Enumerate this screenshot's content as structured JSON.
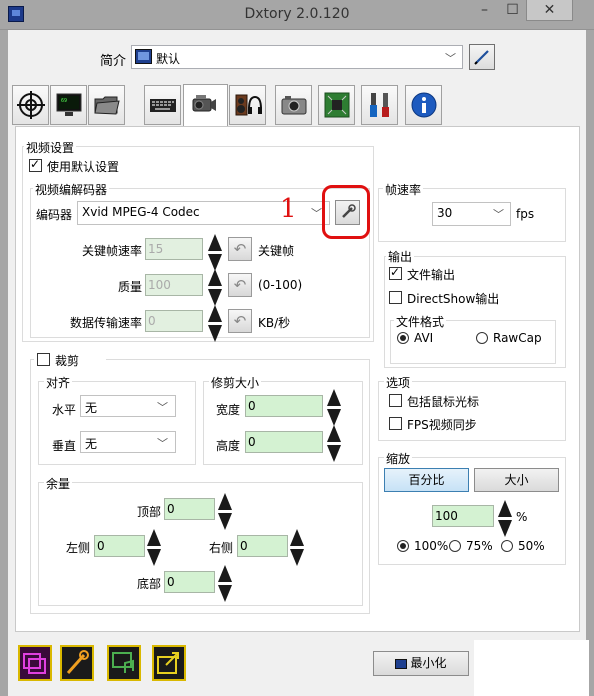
{
  "window": {
    "title": "Dxtory 2.0.120",
    "minimize": "–",
    "maximize": "☐",
    "close": "✕"
  },
  "profile": {
    "label": "简介",
    "value": "默认"
  },
  "tabs": [
    {
      "icon": "crosshair-icon"
    },
    {
      "icon": "monitor-icon"
    },
    {
      "icon": "folder-icon"
    },
    {
      "icon": "keyboard-icon"
    },
    {
      "icon": "video-camera-icon"
    },
    {
      "icon": "speaker-headphones-icon"
    },
    {
      "icon": "photo-camera-icon"
    },
    {
      "icon": "chip-icon"
    },
    {
      "icon": "tools-icon"
    },
    {
      "icon": "info-icon"
    }
  ],
  "video": {
    "section_label": "视频设置",
    "use_default_label": "使用默认设置",
    "codec_group_label": "视频编解码器",
    "codec_label": "编码器",
    "codec_value": "Xvid MPEG-4 Codec",
    "annotation": "1",
    "keyframe_label": "关键帧速率",
    "keyframe_value": "15",
    "keyframe_unit": "关键帧",
    "quality_label": "质量",
    "quality_value": "100",
    "quality_unit": "(0-100)",
    "datarate_label": "数据传输速率",
    "datarate_value": "0",
    "datarate_unit": "KB/秒"
  },
  "fps": {
    "label": "帧速率",
    "value": "30",
    "unit": "fps"
  },
  "output": {
    "label": "输出",
    "file_output": "文件输出",
    "directshow_output": "DirectShow输出",
    "format_label": "文件格式",
    "avi": "AVI",
    "rawcap": "RawCap"
  },
  "options": {
    "label": "选项",
    "include_cursor": "包括鼠标光标",
    "fps_sync": "FPS视频同步"
  },
  "scale": {
    "label": "缩放",
    "percent_btn": "百分比",
    "size_btn": "大小",
    "value": "100",
    "unit": "%",
    "p100": "100%",
    "p75": "75%",
    "p50": "50%"
  },
  "crop": {
    "label": "裁剪",
    "align_label": "对齐",
    "horizontal_label": "水平",
    "horizontal_value": "无",
    "vertical_label": "垂直",
    "vertical_value": "无",
    "trim_label": "修剪大小",
    "width_label": "宽度",
    "width_value": "0",
    "height_label": "高度",
    "height_value": "0",
    "margin_label": "余量",
    "top_label": "顶部",
    "top_value": "0",
    "left_label": "左侧",
    "left_value": "0",
    "right_label": "右侧",
    "right_value": "0",
    "bottom_label": "底部",
    "bottom_value": "0"
  },
  "footer": {
    "minimize_label": "最小化"
  },
  "colors": {
    "annotation": "#e01010",
    "input_bg": "#d4f2d2",
    "selected_btn": "#c7e2f6"
  }
}
